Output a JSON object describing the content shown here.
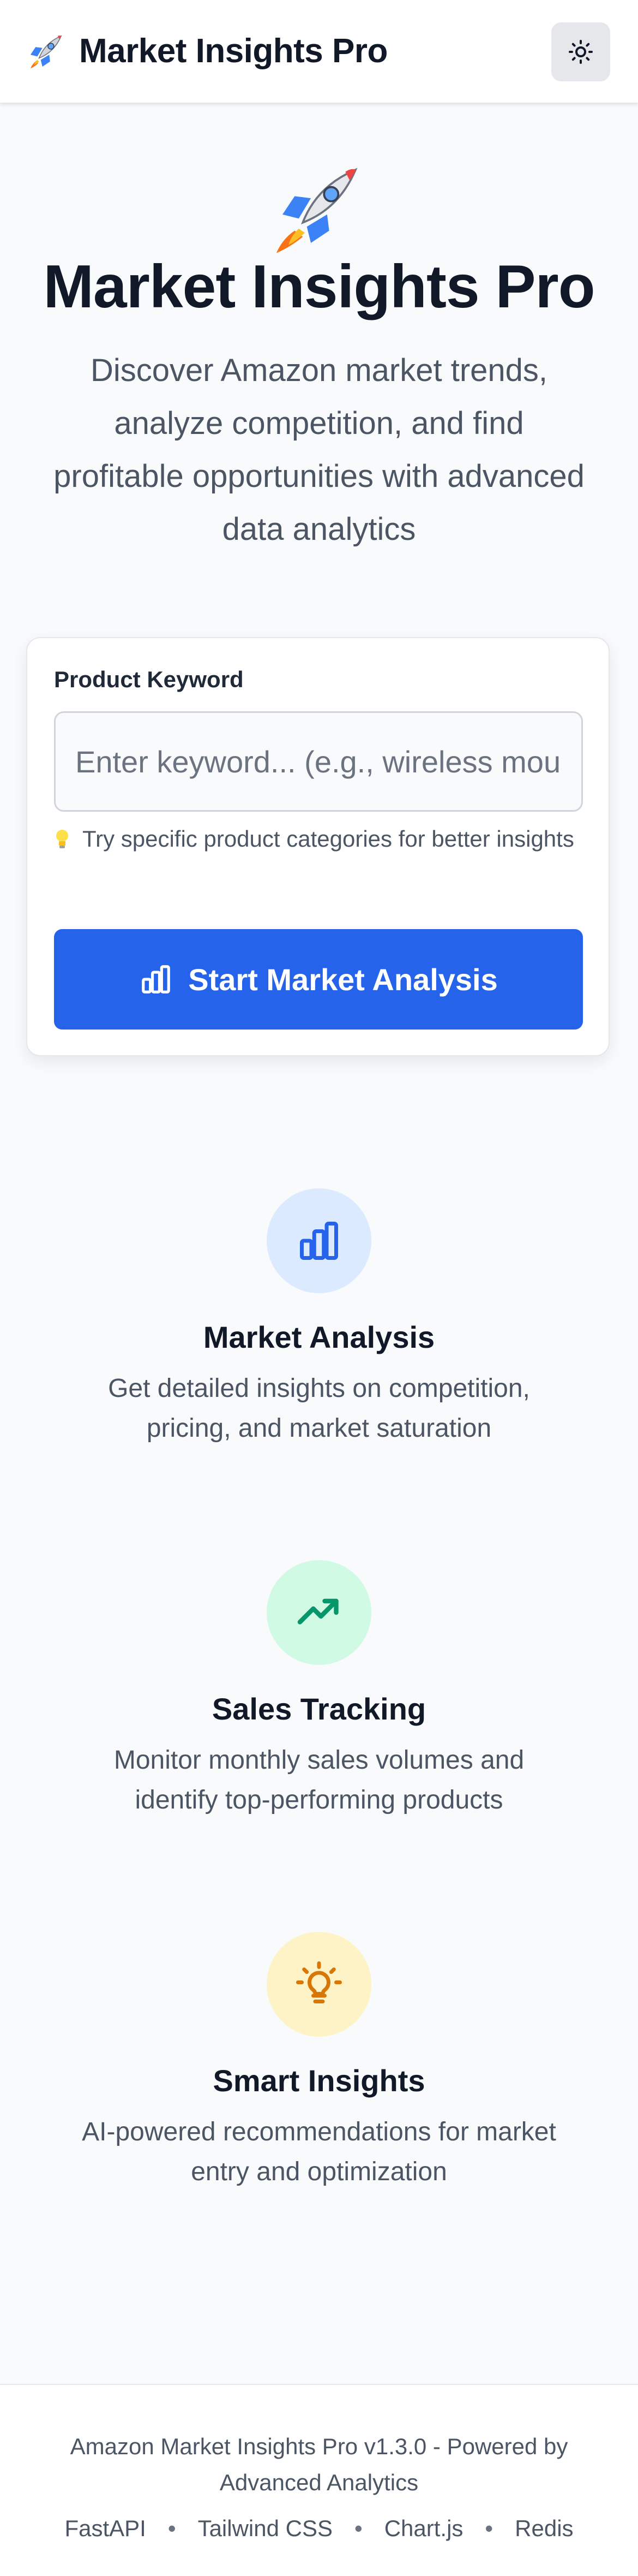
{
  "header": {
    "brand_icon": "rocket-emoji",
    "brand_title": "Market Insights Pro",
    "theme_toggle_icon": "sun-icon"
  },
  "hero": {
    "icon": "rocket-emoji",
    "title": "Market Insights Pro",
    "subtitle": "Discover Amazon market trends, analyze competition, and find profitable opportunities with advanced data analytics"
  },
  "search": {
    "label": "Product Keyword",
    "placeholder": "Enter keyword... (e.g., wireless mouse)",
    "value": "",
    "tip_icon": "lightbulb-emoji",
    "tip": "Try specific product categories for better insights",
    "button_icon": "bar-chart-icon",
    "button_label": "Start Market Analysis"
  },
  "features": [
    {
      "icon": "bar-chart-icon",
      "color": "#2563eb",
      "bg": "#dbeafe",
      "title": "Market Analysis",
      "description": "Get detailed insights on competition, pricing, and market saturation"
    },
    {
      "icon": "trending-up-icon",
      "color": "#059669",
      "bg": "#d1fae5",
      "title": "Sales Tracking",
      "description": "Monitor monthly sales volumes and identify top-performing products"
    },
    {
      "icon": "lightbulb-icon",
      "color": "#d97706",
      "bg": "#fef3c7",
      "title": "Smart Insights",
      "description": "AI-powered recommendations for market entry and optimization"
    }
  ],
  "footer": {
    "text": "Amazon Market Insights Pro v1.3.0 - Powered by Advanced Analytics",
    "separator": "•",
    "links": [
      "FastAPI",
      "Tailwind CSS",
      "Chart.js",
      "Redis"
    ]
  },
  "colors": {
    "primary": "#2563eb",
    "background": "#f8fafc",
    "text": "#111827",
    "muted": "#4b5563"
  }
}
